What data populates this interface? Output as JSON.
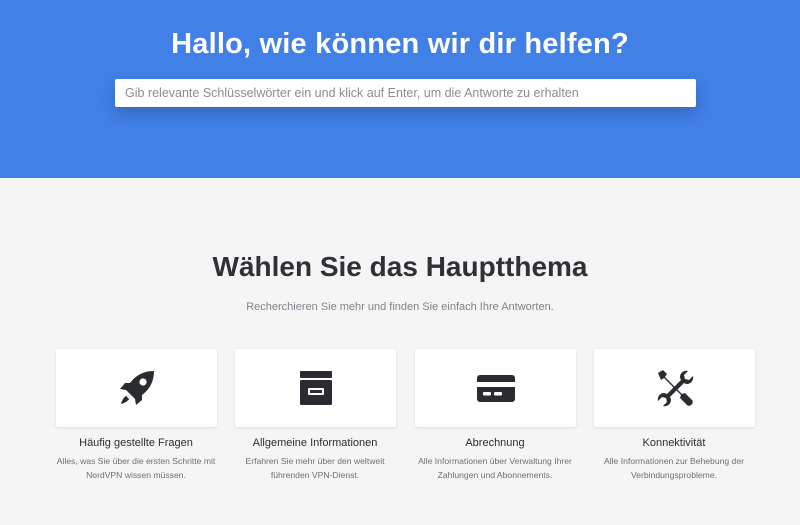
{
  "hero": {
    "title": "Hallo, wie können wir dir helfen?",
    "background_color": "#4180e6",
    "search": {
      "placeholder": "Gib relevante Schlüsselwörter ein und klick auf Enter, um die Antworte zu erhalten",
      "value": ""
    }
  },
  "topics": {
    "title": "Wählen Sie das Hauptthema",
    "subtitle": "Recherchieren Sie mehr und finden Sie einfach Ihre Antworten.",
    "cards": [
      {
        "icon": "rocket-icon",
        "title": "Häufig gestellte Fragen",
        "description": "Alles, was Sie über die ersten Schritte mit NordVPN wissen müssen."
      },
      {
        "icon": "archive-box-icon",
        "title": "Allgemeine Informationen",
        "description": "Erfahren Sie mehr über den weltweit führenden VPN-Dienst."
      },
      {
        "icon": "credit-card-icon",
        "title": "Abrechnung",
        "description": "Alle Informationen über Verwaltung Ihrer Zahlungen und Abonnements."
      },
      {
        "icon": "tools-icon",
        "title": "Konnektivität",
        "description": "Alle Informationen zur Behebung der Verbindungsprobleme."
      }
    ]
  }
}
